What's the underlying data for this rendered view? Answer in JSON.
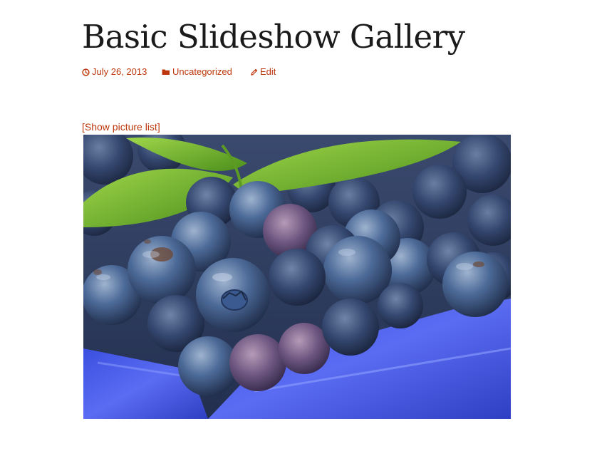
{
  "post": {
    "title": "Basic Slideshow Gallery",
    "meta": {
      "date": "July 26, 2013",
      "category": "Uncategorized",
      "edit": "Edit"
    }
  },
  "gallery": {
    "toggle_label": "[Show picture list]",
    "current_image": "blueberries-photo"
  },
  "colors": {
    "link": "#bc360a",
    "title": "#1a1a1a"
  }
}
